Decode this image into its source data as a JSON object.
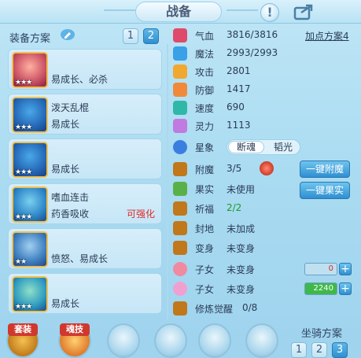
{
  "header": {
    "title": "战备",
    "help_glyph": "!",
    "share_icon": "share-icon"
  },
  "equipment_plan": {
    "label": "装备方案",
    "plans": [
      "1",
      "2"
    ],
    "active_plan": "2"
  },
  "items": [
    {
      "line1": "易成长、必杀",
      "line2": "",
      "stars": "★★★",
      "warn": ""
    },
    {
      "line1": "泼天乱棍",
      "line2": "易成长",
      "stars": "★★★",
      "warn": ""
    },
    {
      "line1": "易成长",
      "line2": "",
      "stars": "★★★",
      "warn": ""
    },
    {
      "line1": "嗜血连击",
      "line2": "药香吸收",
      "stars": "★★★",
      "warn": "可强化"
    },
    {
      "line1": "愤怒、易成长",
      "line2": "",
      "stars": "★★",
      "warn": ""
    },
    {
      "line1": "易成长",
      "line2": "",
      "stars": "★★★",
      "warn": ""
    }
  ],
  "stats": [
    {
      "label": "气血",
      "value": "3816/3816",
      "color": "#e04a6a"
    },
    {
      "label": "魔法",
      "value": "2993/2993",
      "color": "#3aa0e8"
    },
    {
      "label": "攻击",
      "value": "2801",
      "color": "#f0a830"
    },
    {
      "label": "防御",
      "value": "1417",
      "color": "#f08a3a"
    },
    {
      "label": "速度",
      "value": "690",
      "color": "#2fb8a8"
    },
    {
      "label": "灵力",
      "value": "1113",
      "color": "#c07ae0"
    }
  ],
  "point_plan": "加点方案4",
  "xingxiang": {
    "label": "星象",
    "option_a": "断魂",
    "option_b": "韬光"
  },
  "extras": [
    {
      "label": "附魔",
      "value": "3/5",
      "green": false
    },
    {
      "label": "果实",
      "value": "未使用",
      "green": false
    },
    {
      "label": "祈福",
      "value": "2/2",
      "green": true
    },
    {
      "label": "封地",
      "value": "未加成",
      "green": false
    },
    {
      "label": "变身",
      "value": "未变身",
      "green": false
    },
    {
      "label": "子女",
      "value": "未变身",
      "green": false
    },
    {
      "label": "子女",
      "value": "未变身",
      "green": false
    },
    {
      "label": "修炼觉醒",
      "value": "0/8",
      "green": false
    }
  ],
  "buttons": {
    "enchant": "一键附魔",
    "fruit": "一键果实"
  },
  "bars": [
    {
      "value": "0",
      "level": 0.0,
      "color": "#e02a2a"
    },
    {
      "value": "2240",
      "level": 1.0,
      "color": "#1c9a2a"
    }
  ],
  "bottom": {
    "tag1": "套装",
    "tag2": "魂技",
    "mount_plan_label": "坐骑方案",
    "mount_plans": [
      "1",
      "2",
      "3"
    ],
    "active_mount": "3"
  }
}
